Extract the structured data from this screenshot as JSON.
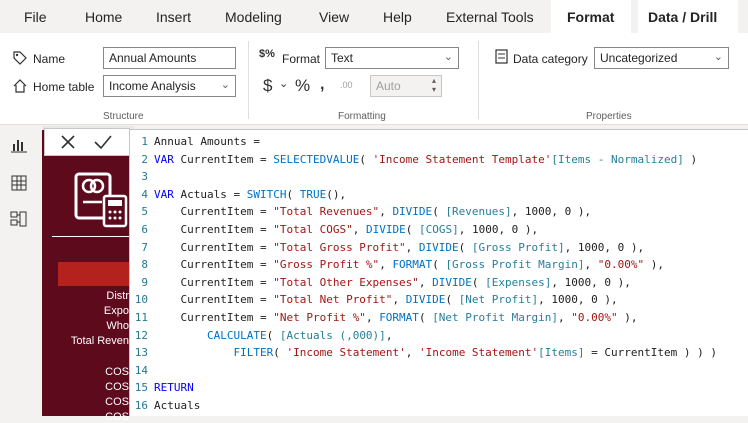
{
  "menu": {
    "tabs": [
      {
        "label": "File"
      },
      {
        "label": "Home"
      },
      {
        "label": "Insert"
      },
      {
        "label": "Modeling"
      },
      {
        "label": "View"
      },
      {
        "label": "Help"
      },
      {
        "label": "External Tools"
      },
      {
        "label": "Format"
      },
      {
        "label": "Data / Drill"
      }
    ]
  },
  "ribbon": {
    "name_label": "Name",
    "name_value": "Annual Amounts",
    "home_table_label": "Home table",
    "home_table_value": "Income Analysis",
    "structure_label": "Structure",
    "format_label": "Format",
    "format_value": "Text",
    "auto_value": "Auto",
    "formatting_label": "Formatting",
    "data_category_label": "Data category",
    "data_category_value": "Uncategorized",
    "properties_label": "Properties",
    "dollar_symbol": "$",
    "percent_symbol": "%",
    "comma_symbol": ",",
    "decimal_symbol": ".00"
  },
  "canvas": {
    "rows_top": [
      "Distr",
      "Expo",
      "Who",
      "Total Reven"
    ],
    "rows_bottom": [
      "COS",
      "COS",
      "COS",
      "COS"
    ]
  },
  "editor": {
    "lines": [
      {
        "n": "1",
        "text": "Annual Amounts ="
      },
      {
        "n": "2",
        "text": "VAR CurrentItem = SELECTEDVALUE( 'Income Statement Template'[Items - Normalized] )"
      },
      {
        "n": "3",
        "text": ""
      },
      {
        "n": "4",
        "text": "VAR Actuals = SWITCH( TRUE(),"
      },
      {
        "n": "5",
        "text": "    CurrentItem = \"Total Revenues\", DIVIDE( [Revenues], 1000, 0 ),"
      },
      {
        "n": "6",
        "text": "    CurrentItem = \"Total COGS\", DIVIDE( [COGS], 1000, 0 ),"
      },
      {
        "n": "7",
        "text": "    CurrentItem = \"Total Gross Profit\", DIVIDE( [Gross Profit], 1000, 0 ),"
      },
      {
        "n": "8",
        "text": "    CurrentItem = \"Gross Profit %\", FORMAT( [Gross Profit Margin], \"0.00%\" ),"
      },
      {
        "n": "9",
        "text": "    CurrentItem = \"Total Other Expenses\", DIVIDE( [Expenses], 1000, 0 ),"
      },
      {
        "n": "10",
        "text": "    CurrentItem = \"Total Net Profit\", DIVIDE( [Net Profit], 1000, 0 ),"
      },
      {
        "n": "11",
        "text": "    CurrentItem = \"Net Profit %\", FORMAT( [Net Profit Margin], \"0.00%\" ),"
      },
      {
        "n": "12",
        "text": "        CALCULATE( [Actuals (,000)],"
      },
      {
        "n": "13",
        "text": "            FILTER( 'Income Statement', 'Income Statement'[Items] = CurrentItem ) ) )"
      },
      {
        "n": "14",
        "text": ""
      },
      {
        "n": "15",
        "text": "RETURN"
      },
      {
        "n": "16",
        "text": "Actuals"
      }
    ]
  }
}
